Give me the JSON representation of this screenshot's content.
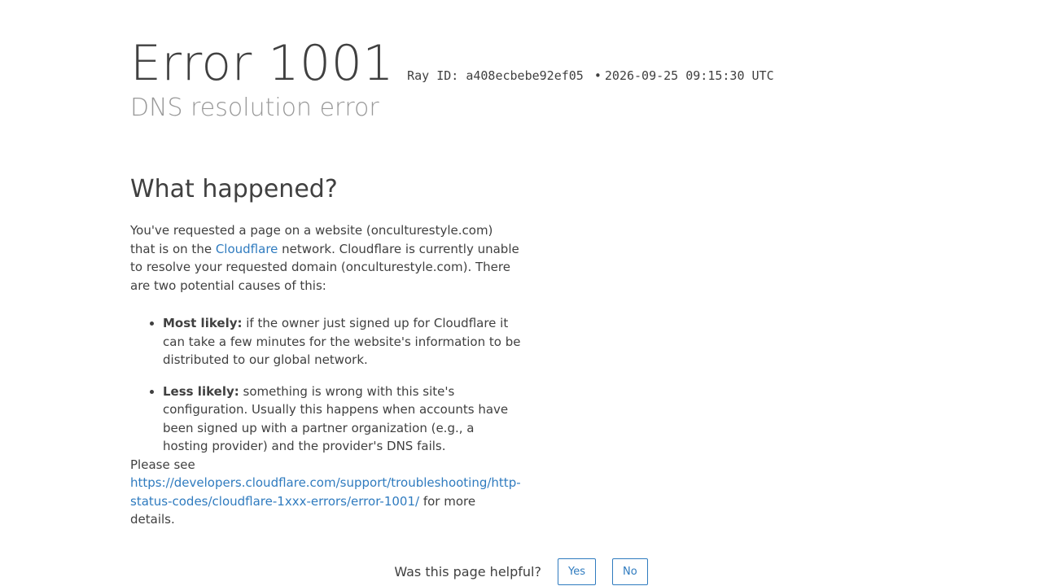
{
  "header": {
    "error_title": "Error 1001",
    "ray_id_label": "Ray ID: a408ecbebe92ef05",
    "separator": "•",
    "timestamp": "2026-09-25 09:15:30 UTC",
    "subtitle": "DNS resolution error"
  },
  "what_happened": {
    "title": "What happened?",
    "intro_part1": "You've requested a page on a website (onculturestyle.com) that is on the ",
    "cloudflare_link": "Cloudflare",
    "intro_part2": " network. Cloudflare is currently unable to resolve your requested domain (onculturestyle.com). There are two potential causes of this:",
    "causes": [
      {
        "label": "Most likely:",
        "text": " if the owner just signed up for Cloudflare it can take a few minutes for the website's information to be distributed to our global network."
      },
      {
        "label": "Less likely:",
        "text": " something is wrong with this site's configuration. Usually this happens when accounts have been signed up with a partner organization (e.g., a hosting provider) and the provider's DNS fails."
      }
    ],
    "please_see": "Please see",
    "details_link": "https://developers.cloudflare.com/support/troubleshooting/http-status-codes/cloudflare-1xxx-errors/error-1001/",
    "details_suffix": " for more details."
  },
  "feedback": {
    "question": "Was this page helpful?",
    "yes_label": "Yes",
    "no_label": "No"
  },
  "colors": {
    "text": "#404040",
    "subtle": "#999999",
    "link": "#2f7bbf"
  }
}
